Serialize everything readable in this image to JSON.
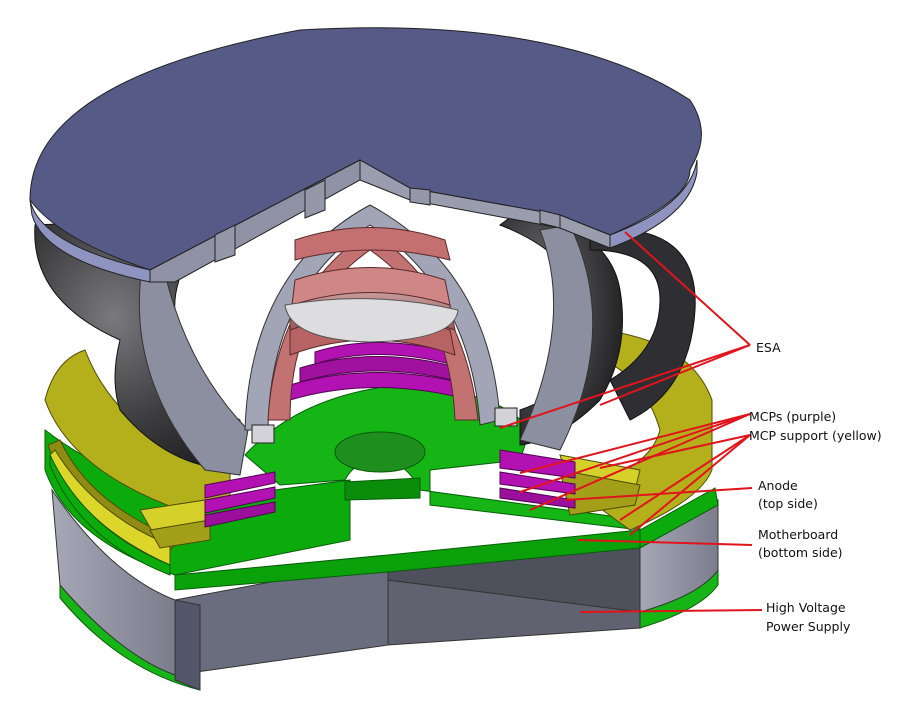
{
  "labels": {
    "esa": "ESA",
    "mcps": "MCPs (purple)",
    "mcp_support": "MCP support (yellow)",
    "anode_line1": "Anode",
    "anode_line2": "(top side)",
    "motherboard_line1": "Motherboard",
    "motherboard_line2": "(bottom side)",
    "hv_line1": "High Voltage",
    "hv_line2": "Power Supply"
  },
  "colors": {
    "leader": "#e0141c",
    "esa_plate": "#555a86",
    "esa_rim": "#8e93c0",
    "mcp": "#b312b3",
    "support": "#b7b31f",
    "anode": "#0ba50b",
    "housing": "#8c8fa0",
    "dome": "#3b3b3d",
    "inner_grey": "#9ea0aa",
    "red_dome": "#b86868"
  }
}
